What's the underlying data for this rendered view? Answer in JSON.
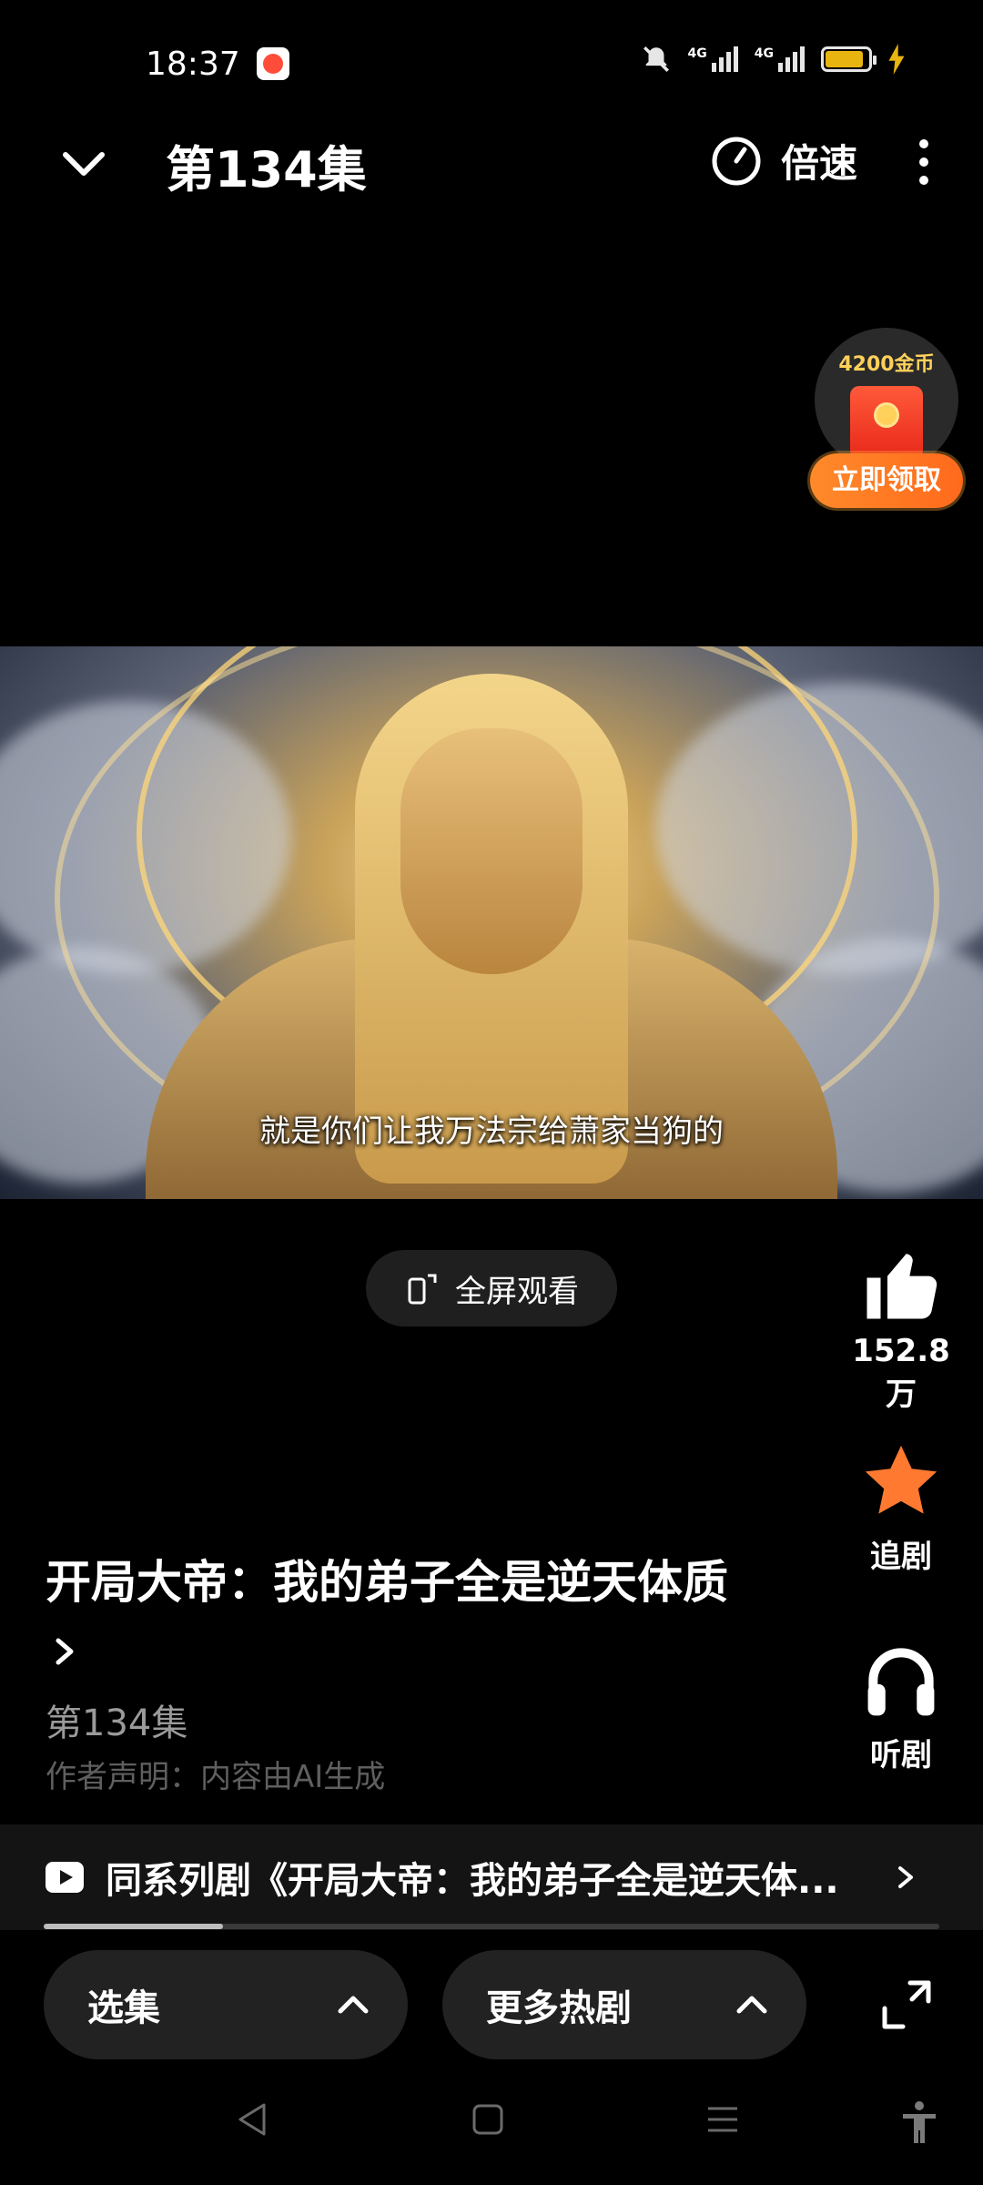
{
  "status_bar": {
    "time": "18:37",
    "net1": "4G",
    "net2": "4G",
    "battery_level": 0.9,
    "colors": {
      "battery": "#e8b40f",
      "charging": "#e8b40f"
    }
  },
  "header": {
    "title": "第134集",
    "speed_label": "倍速"
  },
  "coin_badge": {
    "amount": "4200金币",
    "claim_label": "立即领取"
  },
  "video": {
    "subtitle": "就是你们让我万法宗给萧家当狗的"
  },
  "fullscreen_label": "全屏观看",
  "actions": {
    "like_count": "152.8万",
    "follow_label": "追剧",
    "listen_label": "听剧",
    "colors": {
      "follow_star": "#ff7a30"
    }
  },
  "show": {
    "title": "开局大帝：我的弟子全是逆天体质",
    "episode": "第134集",
    "disclaimer": "作者声明：内容由AI生成"
  },
  "series_banner": {
    "text": "同系列剧《开局大帝：我的弟子全是逆天体..."
  },
  "playback_progress": 0.2,
  "bottom_bar": {
    "episodes_label": "选集",
    "more_label": "更多热剧"
  },
  "icons": [
    "chevron-down-icon",
    "speed-icon",
    "more-vert-icon",
    "like-icon",
    "star-icon",
    "headphones-icon",
    "fullscreen-rotate-icon",
    "play-icon",
    "chevron-right-icon",
    "chevron-up-icon",
    "expand-icon",
    "nav-back-icon",
    "nav-home-icon",
    "nav-menu-icon",
    "accessibility-icon"
  ]
}
